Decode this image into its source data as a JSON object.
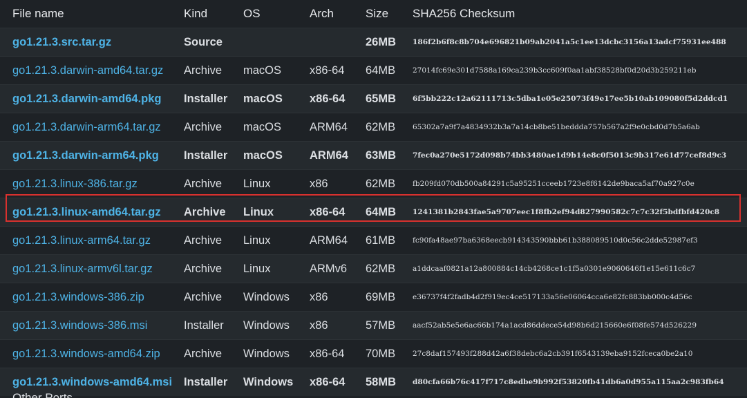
{
  "headers": {
    "file_name": "File name",
    "kind": "Kind",
    "os": "OS",
    "arch": "Arch",
    "size": "Size",
    "checksum": "SHA256 Checksum"
  },
  "rows": [
    {
      "file": "go1.21.3.src.tar.gz",
      "kind": "Source",
      "os": "",
      "arch": "",
      "size": "26MB",
      "sha": "186f2b6f8c8b704e696821b09ab2041a5c1ee13dcbc3156a13adcf75931ee488",
      "featured": true
    },
    {
      "file": "go1.21.3.darwin-amd64.tar.gz",
      "kind": "Archive",
      "os": "macOS",
      "arch": "x86-64",
      "size": "64MB",
      "sha": "27014fc69e301d7588a169ca239b3cc609f0aa1abf38528bf0d20d3b259211eb",
      "featured": false
    },
    {
      "file": "go1.21.3.darwin-amd64.pkg",
      "kind": "Installer",
      "os": "macOS",
      "arch": "x86-64",
      "size": "65MB",
      "sha": "6f5bb222c12a62111713c5dba1e05e25073f49e17ee5b10ab109080f5d2ddcd1",
      "featured": true
    },
    {
      "file": "go1.21.3.darwin-arm64.tar.gz",
      "kind": "Archive",
      "os": "macOS",
      "arch": "ARM64",
      "size": "62MB",
      "sha": "65302a7a9f7a4834932b3a7a14cb8be51beddda757b567a2f9e0cbd0d7b5a6ab",
      "featured": false
    },
    {
      "file": "go1.21.3.darwin-arm64.pkg",
      "kind": "Installer",
      "os": "macOS",
      "arch": "ARM64",
      "size": "63MB",
      "sha": "7fec0a270e5172d098b74bb3480ae1d9b14e8c0f5013c9b317e61d77cef8d9c3",
      "featured": true
    },
    {
      "file": "go1.21.3.linux-386.tar.gz",
      "kind": "Archive",
      "os": "Linux",
      "arch": "x86",
      "size": "62MB",
      "sha": "fb209fd070db500a84291c5a95251cceeb1723e8f6142de9baca5af70a927c0e",
      "featured": false
    },
    {
      "file": "go1.21.3.linux-amd64.tar.gz",
      "kind": "Archive",
      "os": "Linux",
      "arch": "x86-64",
      "size": "64MB",
      "sha": "1241381b2843fae5a9707eec1f8fb2ef94d827990582c7c7c32f5bdfbfd420c8",
      "featured": true
    },
    {
      "file": "go1.21.3.linux-arm64.tar.gz",
      "kind": "Archive",
      "os": "Linux",
      "arch": "ARM64",
      "size": "61MB",
      "sha": "fc90fa48ae97ba6368eecb914343590bbb61b388089510d0c56c2dde52987ef3",
      "featured": false
    },
    {
      "file": "go1.21.3.linux-armv6l.tar.gz",
      "kind": "Archive",
      "os": "Linux",
      "arch": "ARMv6",
      "size": "62MB",
      "sha": "a1ddcaaf0821a12a800884c14cb4268ce1c1f5a0301e9060646f1e15e611c6c7",
      "featured": false
    },
    {
      "file": "go1.21.3.windows-386.zip",
      "kind": "Archive",
      "os": "Windows",
      "arch": "x86",
      "size": "69MB",
      "sha": "e36737f4f2fadb4d2f919ec4ce517133a56e06064cca6e82fc883bb000c4d56c",
      "featured": false
    },
    {
      "file": "go1.21.3.windows-386.msi",
      "kind": "Installer",
      "os": "Windows",
      "arch": "x86",
      "size": "57MB",
      "sha": "aacf52ab5e5e6ac66b174a1acd86ddece54d98b6d215660e6f08fe574d526229",
      "featured": false
    },
    {
      "file": "go1.21.3.windows-amd64.zip",
      "kind": "Archive",
      "os": "Windows",
      "arch": "x86-64",
      "size": "70MB",
      "sha": "27c8daf157493f288d42a6f38debc6a2cb391f6543139eba9152fceca0be2a10",
      "featured": false
    },
    {
      "file": "go1.21.3.windows-amd64.msi",
      "kind": "Installer",
      "os": "Windows",
      "arch": "x86-64",
      "size": "58MB",
      "sha": "d80cfa66b76c417f717c8edbe9b992f53820fb41db6a0d955a115aa2c983fb64",
      "featured": true
    }
  ],
  "highlighted_row": 6,
  "footer_text": "Other Ports",
  "colors": {
    "background": "#1e2226",
    "row_alt": "#252a2e",
    "link": "#4eb3e6",
    "highlight_border": "#d9312e"
  }
}
